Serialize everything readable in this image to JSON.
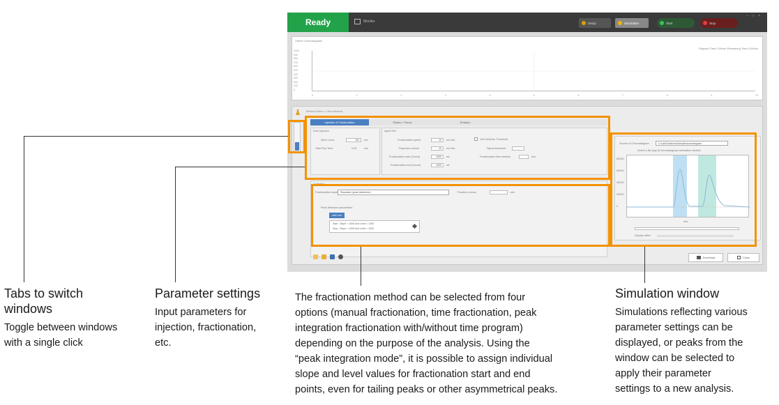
{
  "app": {
    "status": "Ready",
    "monitor_label": "Monitor",
    "toolbar": {
      "setup_label": "Setup",
      "simulation_label": "Simulation",
      "start_label": "Start",
      "stop_label": "Stop"
    },
    "chromatogram": {
      "title": "Online Chromatogram",
      "info": "Elapsed Time  0.00min  Remaining Time  0.00min",
      "y_ticks": [
        "1000",
        "900",
        "800",
        "700",
        "600",
        "500",
        "400",
        "300",
        "200",
        "100",
        "0"
      ],
      "x_ticks": [
        "0",
        "1",
        "2",
        "3",
        "4",
        "5",
        "6",
        "7",
        "8",
        "9",
        "10"
      ]
    },
    "breadcrumb": "Method Editor  >  Ultra Method",
    "tabs": [
      {
        "label": "Injection & Fractionation",
        "active": true
      },
      {
        "label": "Shaker / Pause",
        "active": false
      },
      {
        "label": "Rotation",
        "active": false
      }
    ],
    "injection": {
      "group_label": "Auto Injection",
      "fields": [
        {
          "label": "Slice Count",
          "value": "100",
          "unit": "sec"
        },
        {
          "label": "Total Run Time",
          "value": "0.00",
          "unit": "min"
        }
      ]
    },
    "agent": {
      "group_label": "Agent Set",
      "fields": [
        {
          "label": "Fractionation speed",
          "value": "10",
          "unit": "mL/min"
        },
        {
          "label": "Dispense volume",
          "value": "10",
          "unit": "mL/min"
        },
        {
          "label": "Fractionation start (Count)",
          "value": "1000",
          "unit": "mL"
        },
        {
          "label": "Fractionation end (Count)",
          "value": "1000",
          "unit": "mL"
        }
      ],
      "checkbox_label": "Use Detector Threshold",
      "extra_fields": [
        {
          "label": "Signal threshold",
          "value": ""
        },
        {
          "label": "Fractionation time window",
          "value": "",
          "unit": "min"
        }
      ]
    },
    "collection": {
      "group_label": "Collection",
      "mode_label": "Fractionation mode",
      "mode_value": "Standard (peak detection)",
      "fraction_label": "Fraction volume",
      "fraction_unit": "min",
      "peak_section_label": "Peak detection parameters",
      "add_button": "Add Line",
      "list": [
        "Start :  Slope = 1000  And Level = 1000",
        "Stop  :  Slope = 1000  And Level = 1000"
      ]
    },
    "simulation": {
      "source_label": "Source of Chromatogram",
      "source_value": "C:\\Lab\\Solutions\\Sample\\chromatogram",
      "plot_title": "Select a file (say 5) chromatograph-simulation window",
      "display_label": "Display offset",
      "y_ticks": [
        "80000",
        "60000",
        "40000",
        "20000",
        "0"
      ],
      "x_label": "min"
    },
    "bottom": {
      "download_label": "Download",
      "close_label": "Close"
    }
  },
  "annotations": {
    "tabs": {
      "title_line1": "Tabs to switch",
      "title_line2": "windows",
      "body_line1": "Toggle between windows",
      "body_line2": "with a single click"
    },
    "params": {
      "title": "Parameter settings",
      "body_line1": "Input parameters for",
      "body_line2": "injection, fractionation,",
      "body_line3": "etc."
    },
    "fractionation": {
      "body_line1": "The fractionation method can be selected from four",
      "body_line2": "options (manual fractionation, time fractionation, peak",
      "body_line3": "integration fractionation with/without time program)",
      "body_line4": "depending on the purpose of the analysis. Using the",
      "body_line5": "“peak integration mode”, it is possible to assign individual",
      "body_line6": "slope and level values for fractionation start and end",
      "body_line7": "points, even for tailing peaks or other asymmetrical peaks."
    },
    "simulation": {
      "title": "Simulation window",
      "body_line1": "Simulations reflecting various",
      "body_line2": "parameter settings can be",
      "body_line3": "displayed, or peaks from the",
      "body_line4": "window can be selected to",
      "body_line5": "apply their parameter",
      "body_line6": "settings to a new analysis."
    }
  },
  "colors": {
    "highlight": "#f39200",
    "ready_green": "#22a34a",
    "tab_blue": "#4a7fc1",
    "sim_band": "#9fd0ea"
  }
}
